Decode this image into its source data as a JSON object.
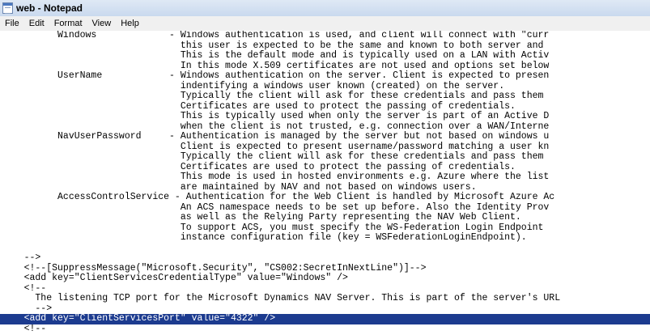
{
  "window": {
    "title": "web - Notepad"
  },
  "menu": [
    "File",
    "Edit",
    "Format",
    "View",
    "Help"
  ],
  "editor": {
    "lines": [
      "          Windows             - Windows authentication is used, and client will connect with \"curr",
      "                                this user is expected to be the same and known to both server and",
      "                                This is the default mode and is typically used on a LAN with Activ",
      "                                In this mode X.509 certificates are not used and options set below",
      "          UserName            - Windows authentication on the server. Client is expected to presen",
      "                                indentifying a windows user known (created) on the server.",
      "                                Typically the client will ask for these credentials and pass them",
      "                                Certificates are used to protect the passing of credentials.",
      "                                This is typically used when only the server is part of an Active D",
      "                                when the client is not trusted, e.g. connection over a WAN/Interne",
      "          NavUserPassword     - Authentication is managed by the server but not based on windows u",
      "                                Client is expected to present username/password matching a user kn",
      "                                Typically the client will ask for these credentials and pass them",
      "                                Certificates are used to protect the passing of credentials.",
      "                                This mode is used in hosted environments e.g. Azure where the list",
      "                                are maintained by NAV and not based on windows users.",
      "          AccessControlService - Authentication for the Web Client is handled by Microsoft Azure Ac",
      "                                An ACS namespace needs to be set up before. Also the Identity Prov",
      "                                as well as the Relying Party representing the NAV Web Client.",
      "                                To support ACS, you must specify the WS-Federation Login Endpoint",
      "                                instance configuration file (key = WSFederationLoginEndpoint).",
      "",
      "    -->",
      "    <!--[SuppressMessage(\"Microsoft.Security\", \"CS002:SecretInNextLine\")]-->",
      "    <add key=\"ClientServicesCredentialType\" value=\"Windows\" />",
      "    <!--",
      "      The listening TCP port for the Microsoft Dynamics NAV Server. This is part of the server's URL",
      "      -->",
      "    <add key=\"ClientServicesPort\" value=\"4322\" />",
      "    <!--"
    ],
    "highlighted_line": 28
  }
}
